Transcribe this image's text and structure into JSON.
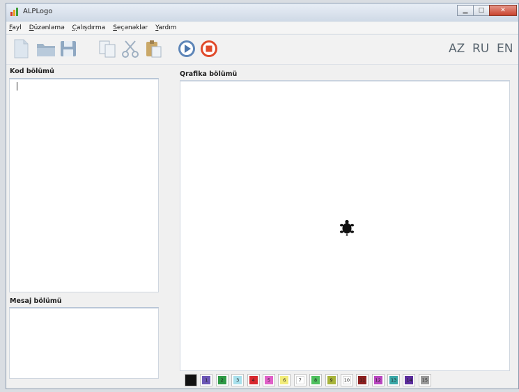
{
  "window": {
    "title": "ALPLogo"
  },
  "menu": {
    "items": [
      "Fayl",
      "Düzənləmə",
      "Çalışdırma",
      "Seçənəklər",
      "Yardım"
    ]
  },
  "toolbar": {
    "icons": [
      "new-file-icon",
      "open-folder-icon",
      "save-icon",
      "copy-icon",
      "cut-icon",
      "paste-icon",
      "run-icon",
      "stop-icon"
    ],
    "languages": [
      "AZ",
      "RU",
      "EN"
    ]
  },
  "panels": {
    "code_label": "Kod bölümü",
    "graphics_label": "Qrafika bölümü",
    "message_label": "Mesaj bölümü"
  },
  "palette": {
    "swatches": [
      {
        "label": "",
        "color": "#111111"
      },
      {
        "label": "1",
        "color": "#6b56b5"
      },
      {
        "label": "2",
        "color": "#2f9a46"
      },
      {
        "label": "3",
        "color": "#a8e0ec"
      },
      {
        "label": "4",
        "color": "#d8282f"
      },
      {
        "label": "5",
        "color": "#e060c8"
      },
      {
        "label": "6",
        "color": "#f2ec7a"
      },
      {
        "label": "7",
        "color": "#ffffff"
      },
      {
        "label": "8",
        "color": "#4ec05e"
      },
      {
        "label": "9",
        "color": "#a7b33a"
      },
      {
        "label": "10",
        "color": "#ffffff"
      },
      {
        "label": "11",
        "color": "#8c1f1f"
      },
      {
        "label": "12",
        "color": "#b946c0"
      },
      {
        "label": "13",
        "color": "#3aa8a8"
      },
      {
        "label": "14",
        "color": "#5b2d9d"
      },
      {
        "label": "15",
        "color": "#9a9a9a"
      }
    ]
  }
}
